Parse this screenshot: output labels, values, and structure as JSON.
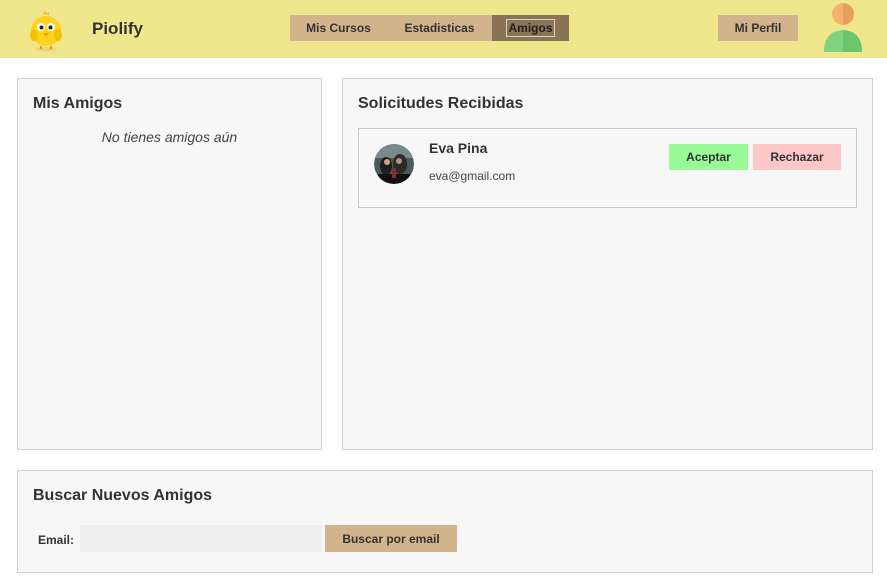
{
  "header": {
    "brand": "Piolify",
    "nav": [
      {
        "label": "Mis Cursos"
      },
      {
        "label": "Estadisticas"
      },
      {
        "label": "Amigos",
        "active": true
      }
    ],
    "profile_label": "Mi Perfil"
  },
  "friends": {
    "title": "Mis Amigos",
    "empty_text": "No tienes amigos aún"
  },
  "requests": {
    "title": "Solicitudes Recibidas",
    "items": [
      {
        "name": "Eva Pina",
        "email": "eva@gmail.com",
        "accept_label": "Aceptar",
        "reject_label": "Rechazar"
      }
    ]
  },
  "search": {
    "title": "Buscar Nuevos Amigos",
    "email_label": "Email:",
    "email_value": "",
    "email_placeholder": "",
    "button_label": "Buscar por email"
  },
  "colors": {
    "header_bg": "#f0e68c",
    "nav_bg": "#d2b48c",
    "nav_active_bg": "#8b7355",
    "accept_bg": "#98fb98",
    "reject_bg": "#ffc8c8",
    "panel_bg": "#f7f7f7"
  }
}
